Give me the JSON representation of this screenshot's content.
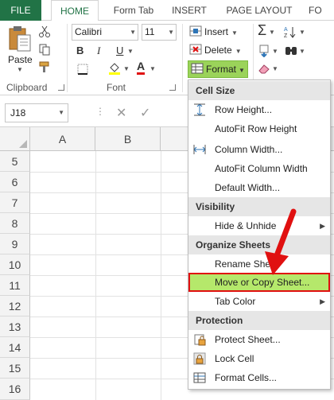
{
  "tabs": [
    {
      "label": "FILE"
    },
    {
      "label": "HOME"
    },
    {
      "label": "Form Tab"
    },
    {
      "label": "INSERT"
    },
    {
      "label": "PAGE LAYOUT"
    },
    {
      "label": "FO"
    }
  ],
  "clipboard": {
    "paste_label": "Paste",
    "group_label": "Clipboard"
  },
  "font": {
    "name": "Calibri",
    "size": "11",
    "bold": "B",
    "italic": "I",
    "underline": "U",
    "color_letter": "A",
    "group_label": "Font"
  },
  "cells": {
    "insert_label": "Insert",
    "delete_label": "Delete",
    "format_label": "Format"
  },
  "name_box": {
    "value": "J18"
  },
  "formula_bar": {
    "cancel": "✕",
    "enter": "✓",
    "dots": "⋮"
  },
  "columns": [
    "A",
    "B"
  ],
  "rows": [
    "5",
    "6",
    "7",
    "8",
    "9",
    "10",
    "11",
    "12",
    "13",
    "14",
    "15",
    "16"
  ],
  "menu": {
    "sections": {
      "cell_size": "Cell Size",
      "visibility": "Visibility",
      "organize": "Organize Sheets",
      "protection": "Protection"
    },
    "items": {
      "row_height": "Row Height...",
      "autofit_row": "AutoFit Row Height",
      "column_width": "Column Width...",
      "autofit_column": "AutoFit Column Width",
      "default_width": "Default Width...",
      "hide_unhide": "Hide & Unhide",
      "rename_sheet": "Rename Sheet",
      "move_copy": "Move or Copy Sheet...",
      "tab_color": "Tab Color",
      "protect_sheet": "Protect Sheet...",
      "lock_cell": "Lock Cell",
      "format_cells": "Format Cells..."
    }
  },
  "colors": {
    "excel_green": "#217346",
    "highlight": "#b5e86b",
    "annotation_red": "#e01010"
  }
}
